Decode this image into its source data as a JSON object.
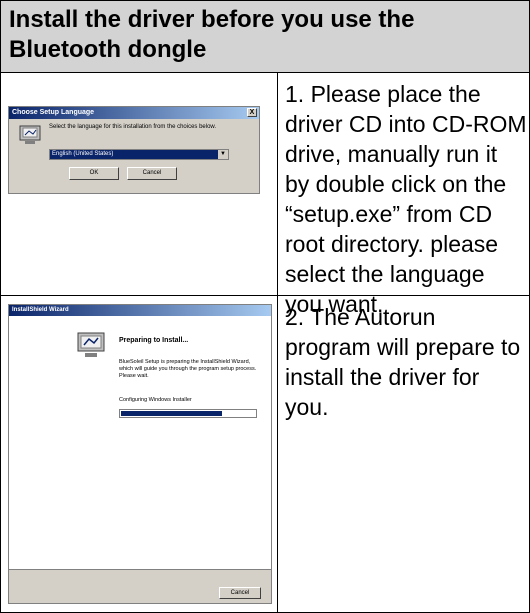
{
  "header": {
    "title": "Install the driver before you use the Bluetooth dongle"
  },
  "rows": [
    {
      "text": "1. Please place the driver CD into CD-ROM drive, manually run it by double click on the “setup.exe” from CD root directory. please   select the language you want.",
      "screenshot": {
        "title": "Choose Setup Language",
        "close": "X",
        "prompt": "Select the language for this installation from the choices below.",
        "selected_language": "English (United States)",
        "ok_label": "OK",
        "cancel_label": "Cancel"
      }
    },
    {
      "text": "2. The Autorun program will prepare to install the driver for you.",
      "screenshot": {
        "title": "InstallShield Wizard",
        "heading": "Preparing to Install...",
        "description": "BlueSoleil Setup is preparing the InstallShield Wizard, which will guide you through the program setup process. Please wait.",
        "status": "Configuring Windows Installer",
        "progress": 0.75,
        "cancel_label": "Cancel"
      }
    }
  ]
}
